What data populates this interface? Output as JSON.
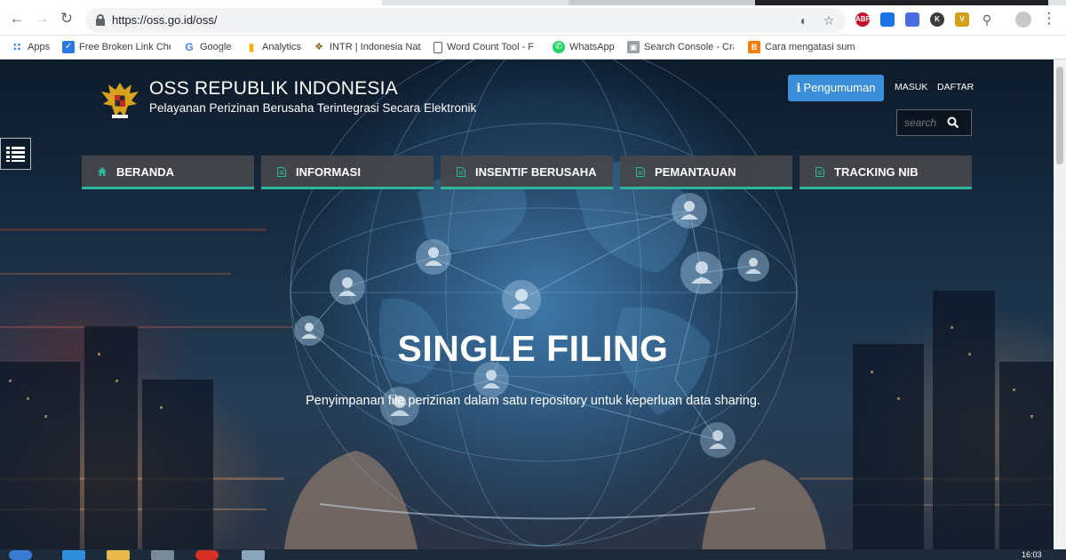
{
  "browser": {
    "url": "https://oss.go.id/oss/",
    "bookmarks": [
      {
        "label": "Apps",
        "icon": "apps-grid-icon"
      },
      {
        "label": "Free Broken Link Che",
        "icon": "broken-link-icon"
      },
      {
        "label": "Google",
        "icon": "google-icon"
      },
      {
        "label": "Analytics",
        "icon": "analytics-icon"
      },
      {
        "label": "INTR | Indonesia Nat",
        "icon": "garuda-icon"
      },
      {
        "label": "Word Count Tool - F",
        "icon": "document-icon"
      },
      {
        "label": "WhatsApp",
        "icon": "whatsapp-icon"
      },
      {
        "label": "Search Console - Cra",
        "icon": "search-console-icon"
      },
      {
        "label": "Cara mengatasi sum",
        "icon": "blog-icon"
      }
    ],
    "extensions": [
      {
        "label": "ABP",
        "color": "#c70d2c"
      },
      {
        "label": "",
        "color": "#1a73e8"
      },
      {
        "label": "",
        "color": "#4a6ee0"
      },
      {
        "label": "K",
        "color": "#3c3c3c"
      },
      {
        "label": "V",
        "color": "#d4a017"
      }
    ]
  },
  "site": {
    "title": "OSS REPUBLIK INDONESIA",
    "subtitle": "Pelayanan Perizinan Berusaha Terintegrasi Secara Elektronik",
    "announcement_label": "Pengumuman",
    "login_label": "MASUK",
    "register_label": "DAFTAR",
    "search_placeholder": "search",
    "nav": [
      {
        "label": "BERANDA",
        "icon": "home-icon"
      },
      {
        "label": "INFORMASI",
        "icon": "document-icon"
      },
      {
        "label": "INSENTIF BERUSAHA",
        "icon": "document-icon"
      },
      {
        "label": "PEMANTAUAN",
        "icon": "document-icon"
      },
      {
        "label": "TRACKING NIB",
        "icon": "document-icon"
      }
    ],
    "hero": {
      "title": "SINGLE FILING",
      "subtitle": "Penyimpanan file perizinan dalam satu repository untuk keperluan data sharing."
    },
    "colors": {
      "accent_green": "#2bb59a",
      "button_blue": "#3a8fd8",
      "nav_bg": "#46464b"
    }
  },
  "taskbar": {
    "clock": "16:03"
  }
}
